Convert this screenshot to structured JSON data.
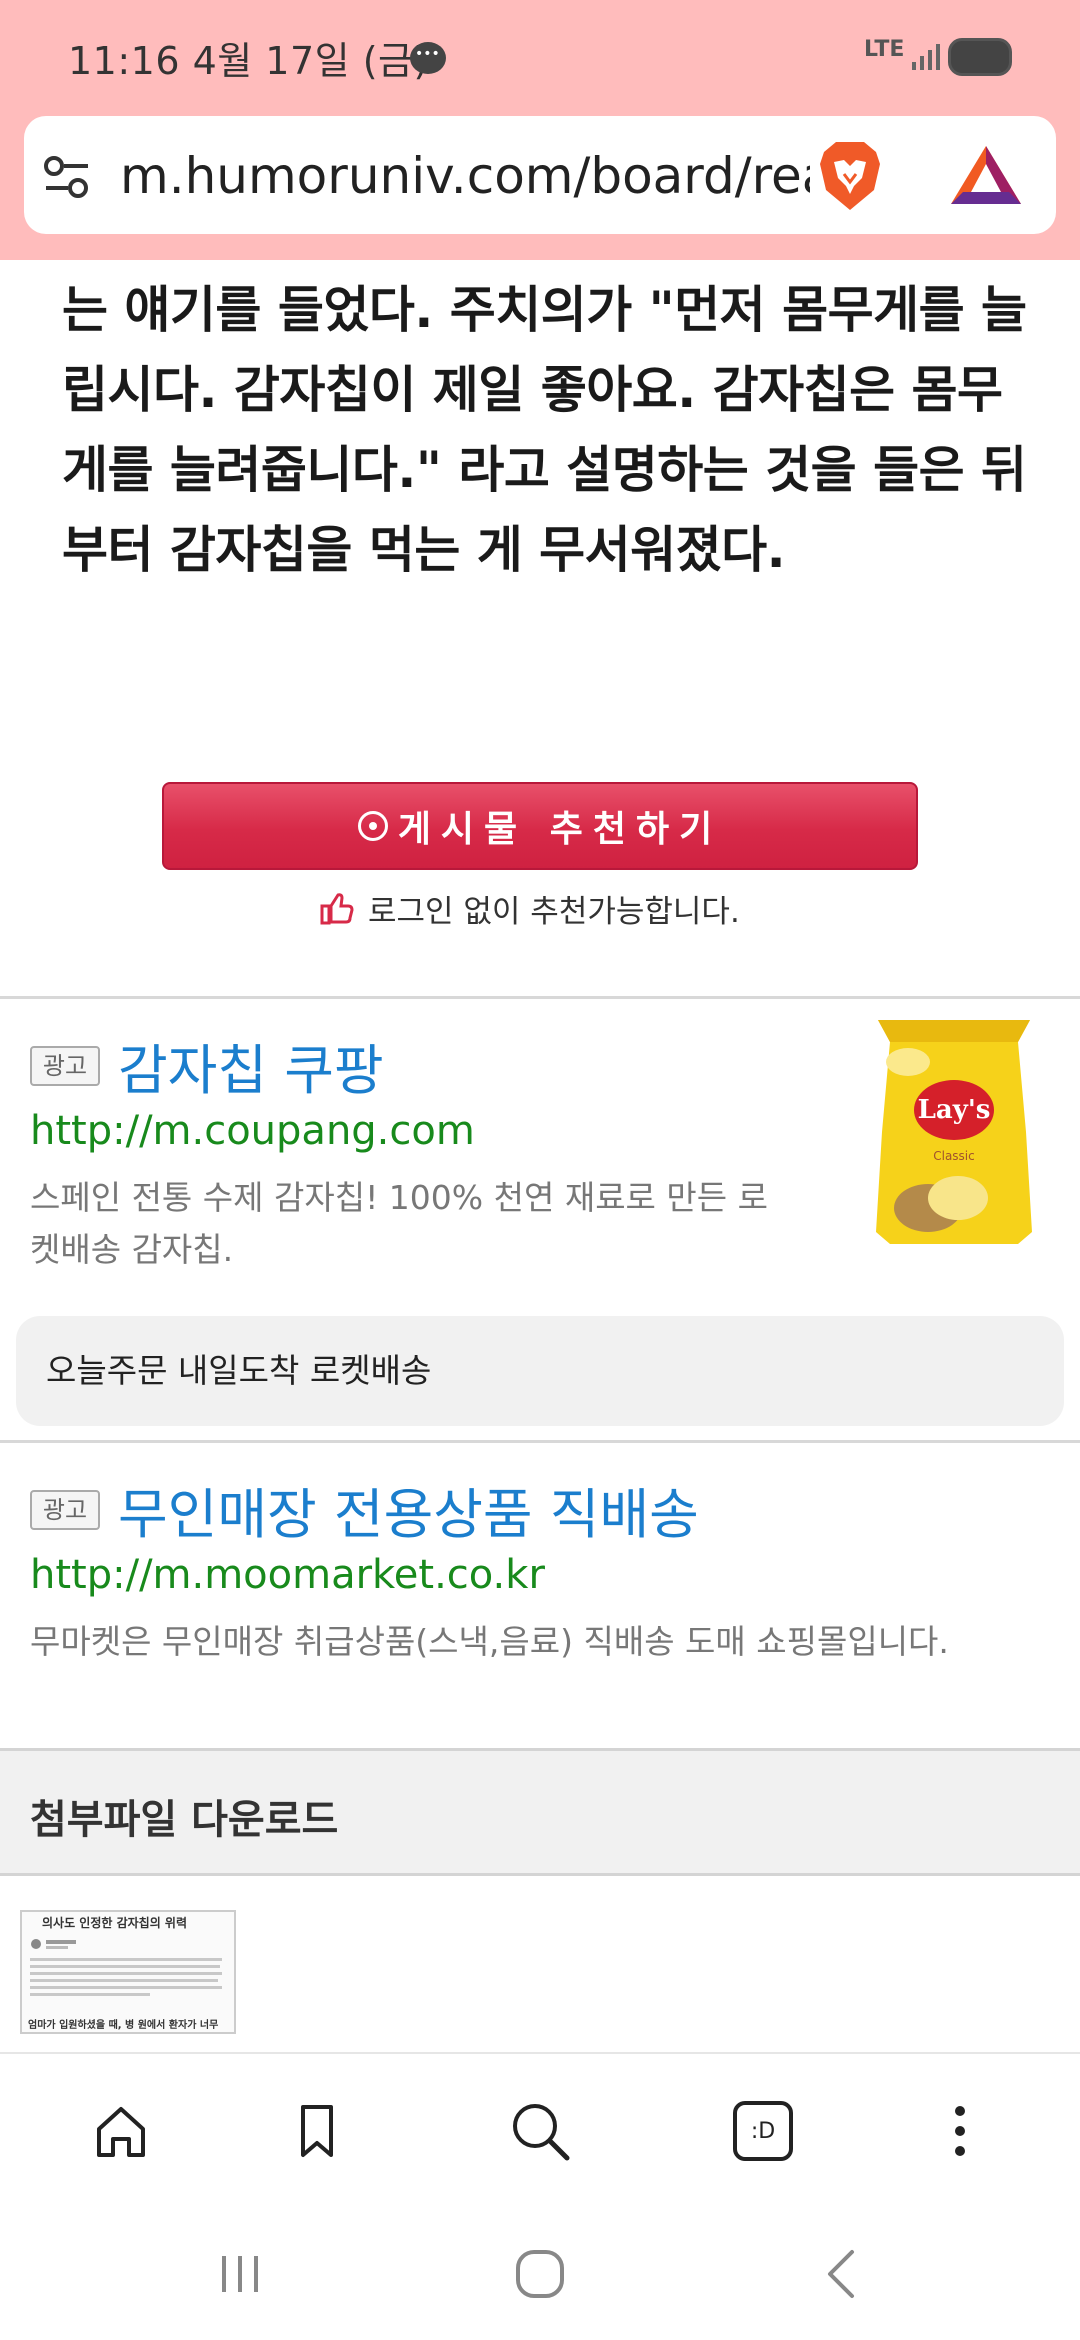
{
  "status_bar": {
    "time": "11:16  4월 17일 (금)",
    "network": "LTE"
  },
  "browser": {
    "url": "m.humoruniv.com/board/read.html"
  },
  "article": {
    "lines": [
      "는 얘기를 들었다. 주치의가 \"먼저 몸무게를 늘",
      "립시다. 감자칩이 제일 좋아요. 감자칩은 몸무",
      "게를 늘려줍니다.\" 라고 설명하는 것을 들은 뒤",
      "부터 감자칩을 먹는 게 무서워졌다."
    ]
  },
  "recommend": {
    "button_label": "게시물 추천하기",
    "note": "로그인 없이 추천가능합니다."
  },
  "ads": [
    {
      "badge": "광고",
      "title": "감자칩 쿠팡",
      "url": "http://m.coupang.com",
      "desc_lines": [
        "스페인 전통 수제 감자칩! 100% 천연 재료로 만든 로",
        "켓배송 감자칩."
      ],
      "sitelink": "오늘주문 내일도착 로켓배송",
      "image_brand": "Lay's",
      "image_label": "Classic"
    },
    {
      "badge": "광고",
      "title": "무인매장 전용상품 직배송",
      "url": "http://m.moomarket.co.kr",
      "desc_lines": [
        "무마켓은 무인매장 취급상품(스낵,음료) 직배송 도매 쇼핑몰입니다."
      ]
    }
  ],
  "attachments": {
    "title": "첨부파일 다운로드",
    "thumb_title": "의사도 인정한 감자칩의 위력",
    "thumb_footer": "엄마가 입원하셨을 때, 병 원에서 환자가 너무"
  },
  "toolbar": {
    "tabs_label": ":D"
  },
  "colors": {
    "top_bar": "#ffbcbc",
    "recommend": "#d72a48",
    "ad_title": "#1b7ecd",
    "ad_url": "#188a1c"
  }
}
